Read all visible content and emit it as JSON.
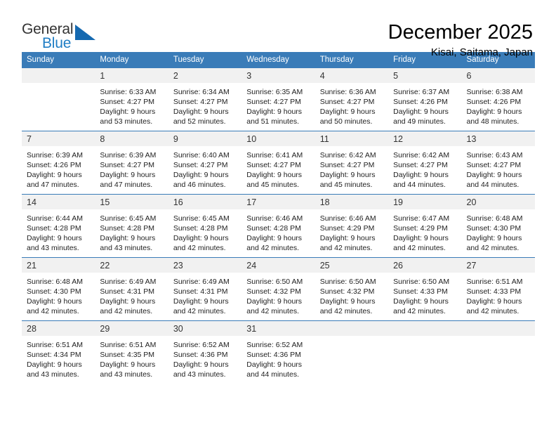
{
  "brand": {
    "name_part1": "General",
    "name_part2": "Blue",
    "triangle_color": "#1569b0",
    "accent_color": "#1f7dc4"
  },
  "header": {
    "title": "December 2025",
    "subtitle": "Kisai, Saitama, Japan"
  },
  "calendar": {
    "header_bg": "#3a7cb8",
    "daynum_bg": "#f1f1f1",
    "weekdays": [
      "Sunday",
      "Monday",
      "Tuesday",
      "Wednesday",
      "Thursday",
      "Friday",
      "Saturday"
    ],
    "weeks": [
      [
        {
          "day": "",
          "lines": []
        },
        {
          "day": "1",
          "lines": [
            "Sunrise: 6:33 AM",
            "Sunset: 4:27 PM",
            "Daylight: 9 hours",
            "and 53 minutes."
          ]
        },
        {
          "day": "2",
          "lines": [
            "Sunrise: 6:34 AM",
            "Sunset: 4:27 PM",
            "Daylight: 9 hours",
            "and 52 minutes."
          ]
        },
        {
          "day": "3",
          "lines": [
            "Sunrise: 6:35 AM",
            "Sunset: 4:27 PM",
            "Daylight: 9 hours",
            "and 51 minutes."
          ]
        },
        {
          "day": "4",
          "lines": [
            "Sunrise: 6:36 AM",
            "Sunset: 4:27 PM",
            "Daylight: 9 hours",
            "and 50 minutes."
          ]
        },
        {
          "day": "5",
          "lines": [
            "Sunrise: 6:37 AM",
            "Sunset: 4:26 PM",
            "Daylight: 9 hours",
            "and 49 minutes."
          ]
        },
        {
          "day": "6",
          "lines": [
            "Sunrise: 6:38 AM",
            "Sunset: 4:26 PM",
            "Daylight: 9 hours",
            "and 48 minutes."
          ]
        }
      ],
      [
        {
          "day": "7",
          "lines": [
            "Sunrise: 6:39 AM",
            "Sunset: 4:26 PM",
            "Daylight: 9 hours",
            "and 47 minutes."
          ]
        },
        {
          "day": "8",
          "lines": [
            "Sunrise: 6:39 AM",
            "Sunset: 4:27 PM",
            "Daylight: 9 hours",
            "and 47 minutes."
          ]
        },
        {
          "day": "9",
          "lines": [
            "Sunrise: 6:40 AM",
            "Sunset: 4:27 PM",
            "Daylight: 9 hours",
            "and 46 minutes."
          ]
        },
        {
          "day": "10",
          "lines": [
            "Sunrise: 6:41 AM",
            "Sunset: 4:27 PM",
            "Daylight: 9 hours",
            "and 45 minutes."
          ]
        },
        {
          "day": "11",
          "lines": [
            "Sunrise: 6:42 AM",
            "Sunset: 4:27 PM",
            "Daylight: 9 hours",
            "and 45 minutes."
          ]
        },
        {
          "day": "12",
          "lines": [
            "Sunrise: 6:42 AM",
            "Sunset: 4:27 PM",
            "Daylight: 9 hours",
            "and 44 minutes."
          ]
        },
        {
          "day": "13",
          "lines": [
            "Sunrise: 6:43 AM",
            "Sunset: 4:27 PM",
            "Daylight: 9 hours",
            "and 44 minutes."
          ]
        }
      ],
      [
        {
          "day": "14",
          "lines": [
            "Sunrise: 6:44 AM",
            "Sunset: 4:28 PM",
            "Daylight: 9 hours",
            "and 43 minutes."
          ]
        },
        {
          "day": "15",
          "lines": [
            "Sunrise: 6:45 AM",
            "Sunset: 4:28 PM",
            "Daylight: 9 hours",
            "and 43 minutes."
          ]
        },
        {
          "day": "16",
          "lines": [
            "Sunrise: 6:45 AM",
            "Sunset: 4:28 PM",
            "Daylight: 9 hours",
            "and 42 minutes."
          ]
        },
        {
          "day": "17",
          "lines": [
            "Sunrise: 6:46 AM",
            "Sunset: 4:28 PM",
            "Daylight: 9 hours",
            "and 42 minutes."
          ]
        },
        {
          "day": "18",
          "lines": [
            "Sunrise: 6:46 AM",
            "Sunset: 4:29 PM",
            "Daylight: 9 hours",
            "and 42 minutes."
          ]
        },
        {
          "day": "19",
          "lines": [
            "Sunrise: 6:47 AM",
            "Sunset: 4:29 PM",
            "Daylight: 9 hours",
            "and 42 minutes."
          ]
        },
        {
          "day": "20",
          "lines": [
            "Sunrise: 6:48 AM",
            "Sunset: 4:30 PM",
            "Daylight: 9 hours",
            "and 42 minutes."
          ]
        }
      ],
      [
        {
          "day": "21",
          "lines": [
            "Sunrise: 6:48 AM",
            "Sunset: 4:30 PM",
            "Daylight: 9 hours",
            "and 42 minutes."
          ]
        },
        {
          "day": "22",
          "lines": [
            "Sunrise: 6:49 AM",
            "Sunset: 4:31 PM",
            "Daylight: 9 hours",
            "and 42 minutes."
          ]
        },
        {
          "day": "23",
          "lines": [
            "Sunrise: 6:49 AM",
            "Sunset: 4:31 PM",
            "Daylight: 9 hours",
            "and 42 minutes."
          ]
        },
        {
          "day": "24",
          "lines": [
            "Sunrise: 6:50 AM",
            "Sunset: 4:32 PM",
            "Daylight: 9 hours",
            "and 42 minutes."
          ]
        },
        {
          "day": "25",
          "lines": [
            "Sunrise: 6:50 AM",
            "Sunset: 4:32 PM",
            "Daylight: 9 hours",
            "and 42 minutes."
          ]
        },
        {
          "day": "26",
          "lines": [
            "Sunrise: 6:50 AM",
            "Sunset: 4:33 PM",
            "Daylight: 9 hours",
            "and 42 minutes."
          ]
        },
        {
          "day": "27",
          "lines": [
            "Sunrise: 6:51 AM",
            "Sunset: 4:33 PM",
            "Daylight: 9 hours",
            "and 42 minutes."
          ]
        }
      ],
      [
        {
          "day": "28",
          "lines": [
            "Sunrise: 6:51 AM",
            "Sunset: 4:34 PM",
            "Daylight: 9 hours",
            "and 43 minutes."
          ]
        },
        {
          "day": "29",
          "lines": [
            "Sunrise: 6:51 AM",
            "Sunset: 4:35 PM",
            "Daylight: 9 hours",
            "and 43 minutes."
          ]
        },
        {
          "day": "30",
          "lines": [
            "Sunrise: 6:52 AM",
            "Sunset: 4:36 PM",
            "Daylight: 9 hours",
            "and 43 minutes."
          ]
        },
        {
          "day": "31",
          "lines": [
            "Sunrise: 6:52 AM",
            "Sunset: 4:36 PM",
            "Daylight: 9 hours",
            "and 44 minutes."
          ]
        },
        {
          "day": "",
          "lines": []
        },
        {
          "day": "",
          "lines": []
        },
        {
          "day": "",
          "lines": []
        }
      ]
    ]
  }
}
